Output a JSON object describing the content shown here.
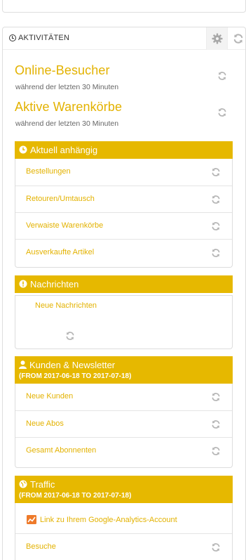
{
  "panel": {
    "title": "AKTIVITÄTEN",
    "header_icons": [
      "gear-icon",
      "refresh-icon"
    ]
  },
  "online": {
    "title": "Online-Besucher",
    "subtitle": "während der letzten 30 Minuten"
  },
  "carts": {
    "title": "Aktive Warenkörbe",
    "subtitle": "während der letzten 30 Minuten"
  },
  "pending": {
    "title": "Aktuell anhängig",
    "items": [
      {
        "label": "Bestellungen"
      },
      {
        "label": "Retouren/Umtausch"
      },
      {
        "label": "Verwaiste Warenkörbe"
      },
      {
        "label": "Ausverkaufte Artikel"
      }
    ]
  },
  "messages": {
    "title": "Nachrichten",
    "new_label": "Neue Nachrichten"
  },
  "customers": {
    "title": "Kunden & Newsletter",
    "range": "(FROM 2017-06-18 TO 2017-07-18)",
    "items": [
      {
        "label": "Neue Kunden"
      },
      {
        "label": "Neue Abos"
      },
      {
        "label": "Gesamt Abonnenten"
      }
    ]
  },
  "traffic": {
    "title": "Traffic",
    "range": "(FROM 2017-06-18 TO 2017-07-18)",
    "ga_link": "Link zu Ihrem Google-Analytics-Account",
    "items": [
      {
        "label": "Besuche"
      }
    ]
  },
  "colors": {
    "accent": "#e6b800",
    "link": "#e3b200",
    "icon_gray": "#b5b5b5"
  }
}
